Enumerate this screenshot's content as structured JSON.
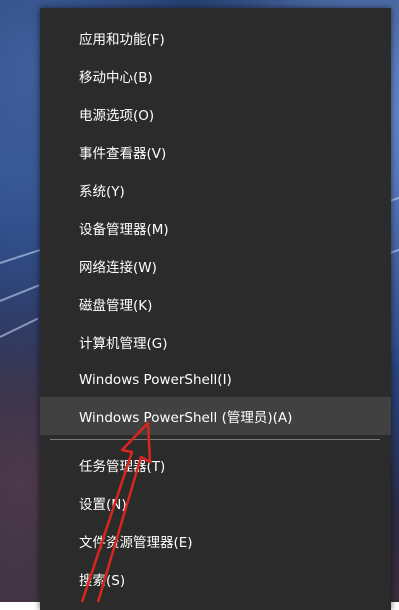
{
  "context_menu": {
    "items": [
      {
        "label": "应用和功能(F)"
      },
      {
        "label": "移动中心(B)"
      },
      {
        "label": "电源选项(O)"
      },
      {
        "label": "事件查看器(V)"
      },
      {
        "label": "系统(Y)"
      },
      {
        "label": "设备管理器(M)"
      },
      {
        "label": "网络连接(W)"
      },
      {
        "label": "磁盘管理(K)"
      },
      {
        "label": "计算机管理(G)"
      },
      {
        "label": "Windows PowerShell(I)"
      },
      {
        "label": "Windows PowerShell (管理员)(A)",
        "state": "highlighted"
      },
      {
        "label": "任务管理器(T)"
      },
      {
        "label": "设置(N)"
      },
      {
        "label": "文件资源管理器(E)"
      },
      {
        "label": "搜索(S)"
      }
    ]
  },
  "annotation": {
    "icon": "red-arrow-icon",
    "color": "#d9261c"
  },
  "colors": {
    "menu_background": "#2b2b2b",
    "highlight_background": "#414141",
    "text": "#ffffff",
    "divider": "#7a7a7a"
  }
}
